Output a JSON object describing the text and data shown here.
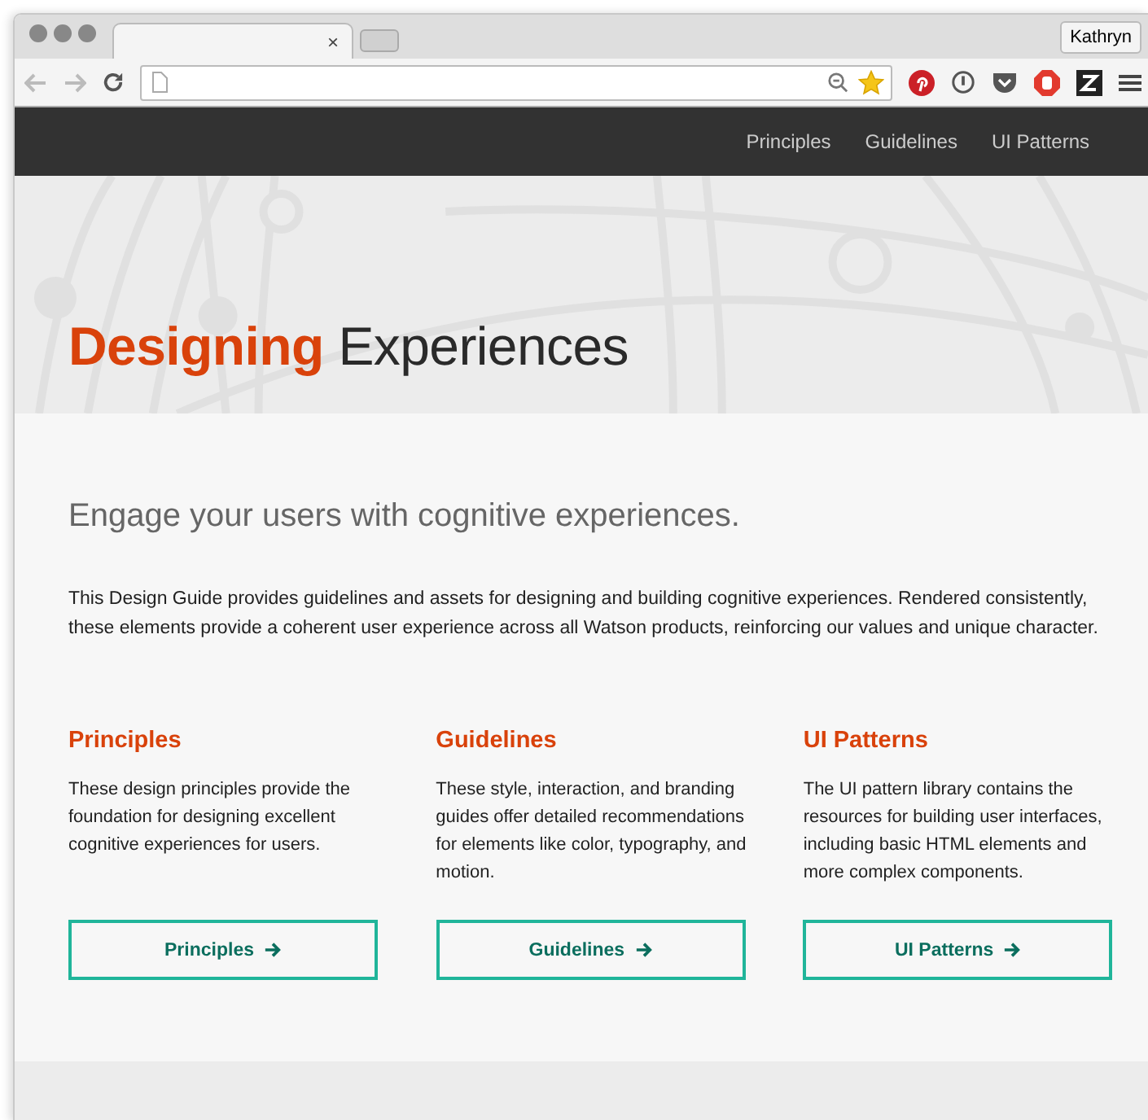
{
  "browser": {
    "tab_close": "×",
    "profile": "Kathryn"
  },
  "nav": {
    "links": [
      {
        "label": "Principles"
      },
      {
        "label": "Guidelines"
      },
      {
        "label": "UI Patterns"
      }
    ]
  },
  "hero": {
    "title_accent": "Designing",
    "title_rest": "Experiences"
  },
  "intro": {
    "heading": "Engage your users with cognitive experiences.",
    "text": "This Design Guide provides guidelines and assets for designing and building cognitive experiences. Rendered consistently, these elements provide a coherent user experience across all Watson products, reinforcing our values and unique character."
  },
  "sections": [
    {
      "title": "Principles",
      "text": "These design principles provide the foundation for designing excellent cognitive experiences for users.",
      "button": "Principles"
    },
    {
      "title": "Guidelines",
      "text": "These style, interaction, and branding guides offer detailed recommendations for elements like color, typography, and motion.",
      "button": "Guidelines"
    },
    {
      "title": "UI Patterns",
      "text": "The UI pattern library contains the resources for building user interfaces, including basic HTML elements and more complex components.",
      "button": "UI Patterns"
    }
  ]
}
